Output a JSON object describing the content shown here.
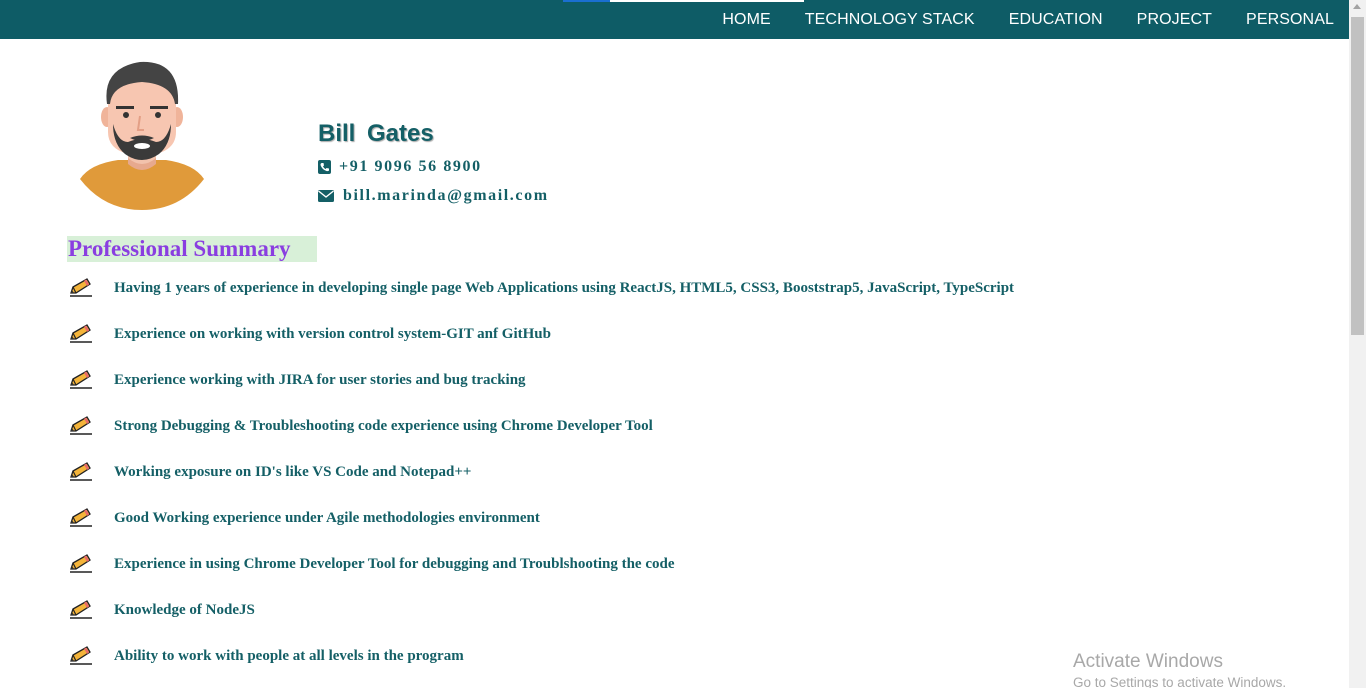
{
  "nav": {
    "items": [
      "HOME",
      "TECHNOLOGY STACK",
      "EDUCATION",
      "PROJECT",
      "PERSONAL"
    ]
  },
  "profile": {
    "name": "Bill  Gates",
    "phone": "+91 9096 56 8900",
    "email": "bill.marinda@gmail.com"
  },
  "summary": {
    "heading": "Professional Summary",
    "items": [
      "Having 1 years of experience in developing single page Web Applications using ReactJS, HTML5, CSS3, Booststrap5, JavaScript, TypeScript",
      "Experience on working with version control system-GIT anf GitHub",
      "Experience working with JIRA for user stories and bug tracking",
      "Strong Debugging & Troubleshooting code experience using Chrome Developer Tool",
      "Working exposure on ID's like VS Code and Notepad++",
      "Good Working experience under Agile methodologies environment",
      "Experience in using Chrome Developer Tool for debugging and Troublshooting the code",
      "Knowledge of NodeJS",
      "Ability to work with people at all levels in the program"
    ]
  },
  "watermark": {
    "title": "Activate Windows",
    "subtitle": "Go to Settings to activate Windows."
  },
  "colors": {
    "navbar": "#0e5c66",
    "text": "#145f66",
    "heading": "#8a3ee0",
    "heading_bg": "#d8f0d8"
  },
  "icons": {
    "list_bullet": "pencil-icon",
    "phone": "phone-icon",
    "email": "envelope-icon"
  }
}
